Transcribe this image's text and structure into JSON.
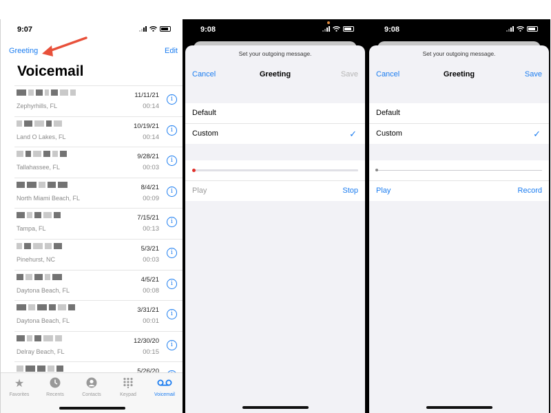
{
  "panel1": {
    "time": "9:07",
    "greeting_link": "Greeting",
    "edit_link": "Edit",
    "title": "Voicemail",
    "voicemails": [
      {
        "location": "Zephyrhills, FL",
        "date": "11/11/21",
        "duration": "00:14"
      },
      {
        "location": "Land O Lakes, FL",
        "date": "10/19/21",
        "duration": "00:14"
      },
      {
        "location": "Tallahassee, FL",
        "date": "9/28/21",
        "duration": "00:03"
      },
      {
        "location": "North Miami Beach, FL",
        "date": "8/4/21",
        "duration": "00:09"
      },
      {
        "location": "Tampa, FL",
        "date": "7/15/21",
        "duration": "00:13"
      },
      {
        "location": "Pinehurst, NC",
        "date": "5/3/21",
        "duration": "00:03"
      },
      {
        "location": "Daytona Beach, FL",
        "date": "4/5/21",
        "duration": "00:08"
      },
      {
        "location": "Daytona Beach, FL",
        "date": "3/31/21",
        "duration": "00:01"
      },
      {
        "location": "Delray Beach, FL",
        "date": "12/30/20",
        "duration": "00:15"
      },
      {
        "location": "",
        "date": "5/26/20",
        "duration": ""
      }
    ],
    "tabs": [
      {
        "label": "Favorites",
        "icon": "star-icon"
      },
      {
        "label": "Recents",
        "icon": "clock-icon"
      },
      {
        "label": "Contacts",
        "icon": "person-icon"
      },
      {
        "label": "Keypad",
        "icon": "keypad-icon"
      },
      {
        "label": "Voicemail",
        "icon": "voicemail-icon"
      }
    ]
  },
  "panel2": {
    "time": "9:08",
    "hint": "Set your outgoing message.",
    "cancel": "Cancel",
    "title": "Greeting",
    "save": "Save",
    "option_default": "Default",
    "option_custom": "Custom",
    "play": "Play",
    "action": "Stop"
  },
  "panel3": {
    "time": "9:08",
    "hint": "Set your outgoing message.",
    "cancel": "Cancel",
    "title": "Greeting",
    "save": "Save",
    "option_default": "Default",
    "option_custom": "Custom",
    "play": "Play",
    "action": "Record"
  },
  "colors": {
    "accent": "#1a7cf0",
    "arrow": "#e8503a",
    "record": "#e0302a"
  }
}
